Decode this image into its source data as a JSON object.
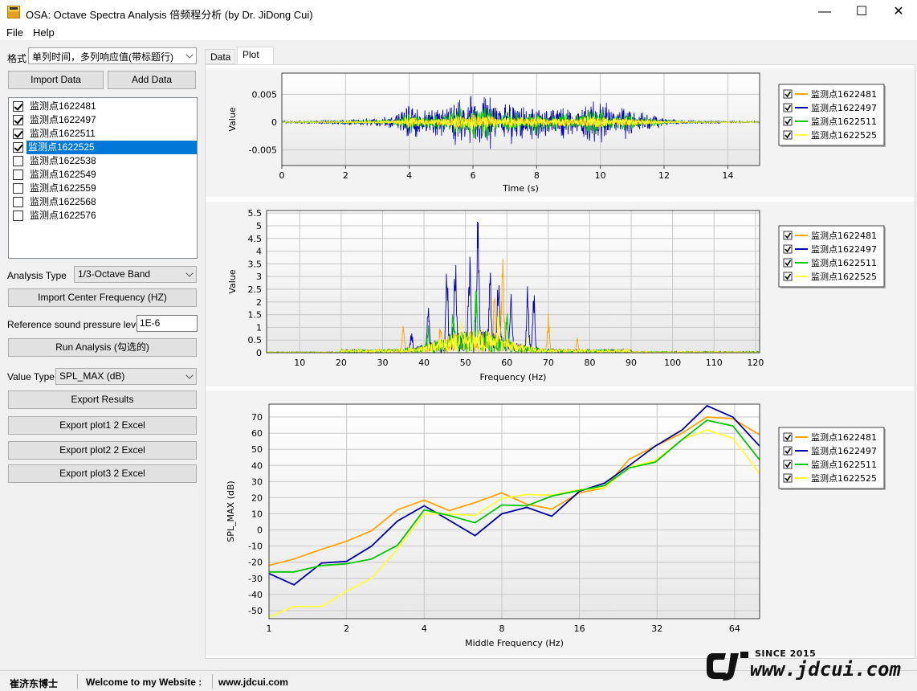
{
  "window": {
    "title": "OSA: Octave Spectra Analysis 倍频程分析 (by Dr. JiDong Cui)",
    "minimize": "—",
    "maximize": "☐",
    "close": "✕"
  },
  "menu": {
    "file": "File",
    "help": "Help"
  },
  "left": {
    "format_label": "格式",
    "format_value": "单列时间，多列响应值(带标题行)",
    "import_data": "Import Data",
    "add_data": "Add Data",
    "channels": [
      {
        "label": "监测点1622481",
        "checked": true,
        "selected": false
      },
      {
        "label": "监测点1622497",
        "checked": true,
        "selected": false
      },
      {
        "label": "监测点1622511",
        "checked": true,
        "selected": false
      },
      {
        "label": "监测点1622525",
        "checked": true,
        "selected": true
      },
      {
        "label": "监测点1622538",
        "checked": false,
        "selected": false
      },
      {
        "label": "监测点1622549",
        "checked": false,
        "selected": false
      },
      {
        "label": "监测点1622559",
        "checked": false,
        "selected": false
      },
      {
        "label": "监测点1622568",
        "checked": false,
        "selected": false
      },
      {
        "label": "监测点1622576",
        "checked": false,
        "selected": false
      }
    ],
    "analysis_type_label": "Analysis Type",
    "analysis_type_value": "1/3-Octave Band",
    "import_center_freq": "Import Center Frequency (HZ)",
    "ref_pressure_label": "Reference sound pressure level",
    "ref_pressure_value": "1E-6",
    "run_analysis": "Run Analysis (勾选的)",
    "value_type_label": "Value Type",
    "value_type_value": "SPL_MAX (dB)",
    "export_results": "Export Results",
    "export_plot1": "Export plot1 2 Excel",
    "export_plot2": "Export plot2 2 Excel",
    "export_plot3": "Export plot3 2 Excel"
  },
  "tabs": [
    {
      "label": "Data",
      "active": false
    },
    {
      "label": "Plot",
      "active": true
    }
  ],
  "status": {
    "author": "崔济东博士",
    "welcome": "Welcome to my Website :",
    "url": "www.jdcui.com"
  },
  "logo": {
    "since": "SINCE 2015",
    "url": "www.jdcui.com"
  },
  "colors": {
    "s1": "#ffa500",
    "s2": "#0000b4",
    "s3": "#00c800",
    "s4": "#ffff32",
    "grid": "#c8c8c8",
    "panel": "#f3f3f3"
  },
  "chart_data": [
    {
      "type": "line",
      "xlabel": "Time (s)",
      "ylabel": "Value",
      "xlim": [
        0,
        15
      ],
      "ylim": [
        -0.0078,
        0.0088
      ],
      "xticks": [
        0,
        2,
        4,
        6,
        8,
        10,
        12,
        14
      ],
      "yticks": [
        -0.005,
        0,
        0.005
      ],
      "ytick_labels": [
        "-0.005",
        "0",
        "0.005"
      ],
      "legend": [
        "监测点1622481",
        "监测点1622497",
        "监测点1622511",
        "监测点1622525"
      ],
      "envelope": {
        "t": [
          0,
          1,
          2,
          3,
          3.6,
          4,
          4.4,
          4.8,
          5.2,
          5.6,
          5.8,
          6.0,
          6.2,
          6.5,
          6.8,
          7.2,
          7.6,
          8.0,
          8.4,
          8.8,
          9.2,
          9.6,
          10.0,
          10.4,
          10.8,
          11.2,
          11.6,
          12.0,
          12.6,
          13,
          14,
          15
        ],
        "s2_amp": [
          0.0002,
          0.0003,
          0.0005,
          0.0008,
          0.0012,
          0.0042,
          0.0022,
          0.0026,
          0.0032,
          0.0055,
          0.0028,
          0.0068,
          0.0045,
          0.0062,
          0.002,
          0.0042,
          0.003,
          0.004,
          0.0022,
          0.0038,
          0.002,
          0.004,
          0.0048,
          0.0024,
          0.0035,
          0.002,
          0.0018,
          0.0008,
          0.0004,
          0.0003,
          0.0002,
          0.0002
        ],
        "s3_scale": 0.55,
        "s4_scale": 0.32,
        "s1_scale": 0.25
      }
    },
    {
      "type": "line",
      "xlabel": "Frequency (Hz)",
      "ylabel": "Value",
      "xlim": [
        2,
        121
      ],
      "ylim": [
        0,
        5.6
      ],
      "xticks": [
        10,
        20,
        30,
        40,
        50,
        60,
        70,
        80,
        90,
        100,
        110,
        120
      ],
      "yticks": [
        0,
        0.5,
        1,
        1.5,
        2,
        2.5,
        3,
        3.5,
        4,
        4.5,
        5,
        5.5
      ],
      "ytick_labels": [
        "0",
        "0.5",
        "1",
        "1.5",
        "2",
        "2.5",
        "3",
        "3.5",
        "4",
        "4.5",
        "5",
        "5.5"
      ],
      "legend": [
        "监测点1622481",
        "监测点1622497",
        "监测点1622511",
        "监测点1622525"
      ],
      "peaks": [
        {
          "series": "s2",
          "f": 45.5,
          "v": 3.5
        },
        {
          "series": "s2",
          "f": 47.5,
          "v": 3.6
        },
        {
          "series": "s2",
          "f": 53,
          "v": 5.6
        },
        {
          "series": "s2",
          "f": 51,
          "v": 3.6
        },
        {
          "series": "s2",
          "f": 56,
          "v": 2.7
        },
        {
          "series": "s2",
          "f": 58,
          "v": 3.1
        },
        {
          "series": "s2",
          "f": 61,
          "v": 2.1
        },
        {
          "series": "s2",
          "f": 65,
          "v": 2.7
        },
        {
          "series": "s2",
          "f": 66.5,
          "v": 2.6
        },
        {
          "series": "s2",
          "f": 41,
          "v": 1.9
        },
        {
          "series": "s2",
          "f": 37,
          "v": 0.8
        },
        {
          "series": "s1",
          "f": 59,
          "v": 3.7
        },
        {
          "series": "s1",
          "f": 57,
          "v": 1.8
        },
        {
          "series": "s1",
          "f": 70,
          "v": 1.5
        },
        {
          "series": "s1",
          "f": 35,
          "v": 1.0
        },
        {
          "series": "s1",
          "f": 44,
          "v": 0.9
        },
        {
          "series": "s1",
          "f": 77,
          "v": 0.5
        },
        {
          "series": "s3",
          "f": 52.5,
          "v": 2.3
        },
        {
          "series": "s3",
          "f": 47,
          "v": 1.2
        },
        {
          "series": "s3",
          "f": 60,
          "v": 1.5
        },
        {
          "series": "s3",
          "f": 41,
          "v": 0.8
        },
        {
          "series": "s4",
          "f": 58,
          "v": 1.3
        },
        {
          "series": "s4",
          "f": 49,
          "v": 0.6
        },
        {
          "series": "s4",
          "f": 65,
          "v": 0.5
        }
      ]
    },
    {
      "type": "line",
      "xscale": "log2",
      "xlabel": "Middle Frequency (Hz)",
      "ylabel": "SPL_MAX (dB)",
      "xlim": [
        1,
        80
      ],
      "ylim": [
        -55,
        78
      ],
      "xticks": [
        1,
        2,
        4,
        8,
        16,
        32,
        64
      ],
      "yticks": [
        -50,
        -40,
        -30,
        -20,
        -10,
        0,
        10,
        20,
        30,
        40,
        50,
        60,
        70
      ],
      "ytick_labels": [
        "-50",
        "-40",
        "-30",
        "-20",
        "-10",
        "0",
        "10",
        "20",
        "30",
        "40",
        "50",
        "60",
        "70"
      ],
      "x": [
        1,
        1.25,
        1.6,
        2,
        2.5,
        3.15,
        4,
        5,
        6.3,
        8,
        10,
        12.5,
        16,
        20,
        25,
        31.5,
        40,
        50,
        63,
        80
      ],
      "series": [
        {
          "name": "监测点1622481",
          "values": [
            -22,
            -18,
            -12,
            -7,
            -0.5,
            12.5,
            18.5,
            12,
            17,
            23,
            16,
            13,
            23,
            26,
            44,
            52,
            60,
            70,
            69,
            59
          ]
        },
        {
          "name": "监测点1622497",
          "values": [
            -27,
            -34,
            -20.5,
            -19.5,
            -10,
            5.5,
            15,
            6,
            -3.5,
            10,
            14,
            8.5,
            24,
            29,
            40,
            52,
            62,
            77,
            70,
            52
          ]
        },
        {
          "name": "监测点1622511",
          "values": [
            -26,
            -26,
            -22,
            -21,
            -18,
            -9.5,
            12.5,
            9,
            4.5,
            15.5,
            15,
            21,
            24.5,
            27.5,
            38.5,
            42,
            56,
            68,
            64.5,
            43.5
          ]
        },
        {
          "name": "监测点1622525",
          "values": [
            -54,
            -47.5,
            -47.5,
            -38,
            -30,
            -12,
            10,
            10,
            9,
            19.5,
            22,
            21.5,
            25,
            26,
            39,
            43,
            56,
            62,
            57,
            35
          ]
        }
      ],
      "legend": [
        "监测点1622481",
        "监测点1622497",
        "监测点1622511",
        "监测点1622525"
      ]
    }
  ]
}
